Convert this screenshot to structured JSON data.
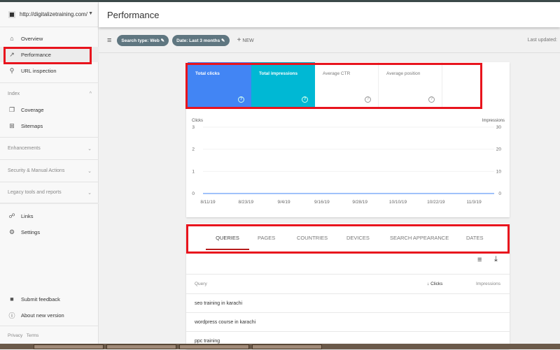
{
  "property": "http://digitalizetraining.com/",
  "header": {
    "title": "Performance",
    "last_updated": "Last updated:"
  },
  "sidebar": {
    "items": [
      {
        "label": "Overview",
        "icon": "home-icon"
      },
      {
        "label": "Performance",
        "icon": "trending-up-icon"
      },
      {
        "label": "URL inspection",
        "icon": "search-icon"
      }
    ],
    "index": {
      "label": "Index",
      "items": [
        {
          "label": "Coverage",
          "icon": "coverage-icon"
        },
        {
          "label": "Sitemaps",
          "icon": "sitemap-icon"
        }
      ]
    },
    "sections": [
      "Enhancements",
      "Security & Manual Actions",
      "Legacy tools and reports"
    ],
    "more": [
      {
        "label": "Links",
        "icon": "links-icon"
      },
      {
        "label": "Settings",
        "icon": "gear-icon"
      }
    ],
    "footer_items": [
      {
        "label": "Submit feedback",
        "icon": "feedback-icon"
      },
      {
        "label": "About new version",
        "icon": "info-icon"
      }
    ],
    "privacy": "Privacy",
    "terms": "Terms"
  },
  "filters": {
    "chips": [
      "Search type: Web",
      "Date: Last 3 months"
    ],
    "new": "NEW"
  },
  "metrics": [
    {
      "label": "Total clicks",
      "color": "#4285f4",
      "active": true
    },
    {
      "label": "Total impressions",
      "color": "#00b8d4",
      "active": true
    },
    {
      "label": "Average CTR",
      "active": false
    },
    {
      "label": "Average position",
      "active": false
    }
  ],
  "chart_data": {
    "type": "line",
    "left_label": "Clicks",
    "right_label": "Impressions",
    "left_ticks": [
      "0",
      "1",
      "2",
      "3"
    ],
    "right_ticks": [
      "0",
      "10",
      "20",
      "30"
    ],
    "x_ticks": [
      "8/11/19",
      "8/23/19",
      "9/4/19",
      "9/16/19",
      "9/28/19",
      "10/10/19",
      "10/22/19",
      "11/3/19"
    ],
    "ylim_left": [
      0,
      3
    ],
    "ylim_right": [
      0,
      30
    ]
  },
  "tabs": [
    "QUERIES",
    "PAGES",
    "COUNTRIES",
    "DEVICES",
    "SEARCH APPEARANCE",
    "DATES"
  ],
  "table": {
    "columns": [
      "Query",
      "Clicks",
      "Impressions"
    ],
    "rows": [
      "seo training in karachi",
      "wordpress course in karachi",
      "ppc training"
    ]
  }
}
